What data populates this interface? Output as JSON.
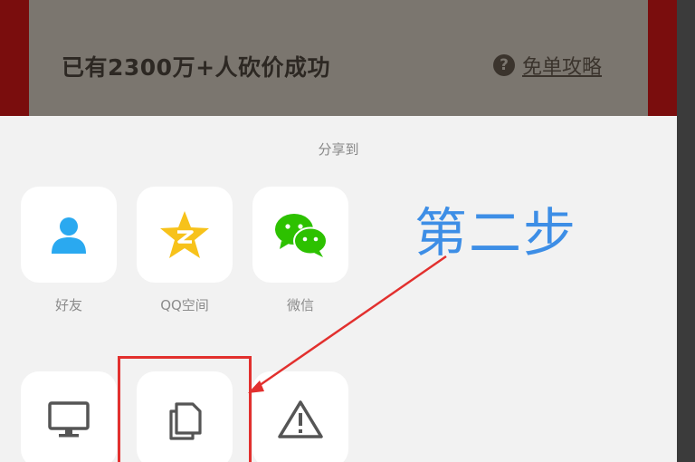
{
  "background_page": {
    "headline": "已有2300万+人砍价成功",
    "guide_link": "免单攻略",
    "help_icon_glyph": "?"
  },
  "share_sheet": {
    "title": "分享到",
    "row1": [
      {
        "label": "好友",
        "icon": "person-icon"
      },
      {
        "label": "QQ空间",
        "icon": "qzone-star-icon"
      },
      {
        "label": "微信",
        "icon": "wechat-icon"
      }
    ],
    "row2": [
      {
        "label": "",
        "icon": "monitor-icon"
      },
      {
        "label": "",
        "icon": "copy-icon"
      },
      {
        "label": "",
        "icon": "warning-icon"
      }
    ]
  },
  "annotation": {
    "step_text": "第二步",
    "text_color": "#3d8ee6",
    "box_color": "#e2302e"
  },
  "colors": {
    "qq_blue": "#2aa9f0",
    "qzone_yellow": "#f7c21b",
    "wechat_green": "#2dc100",
    "icon_gray": "#555555"
  }
}
